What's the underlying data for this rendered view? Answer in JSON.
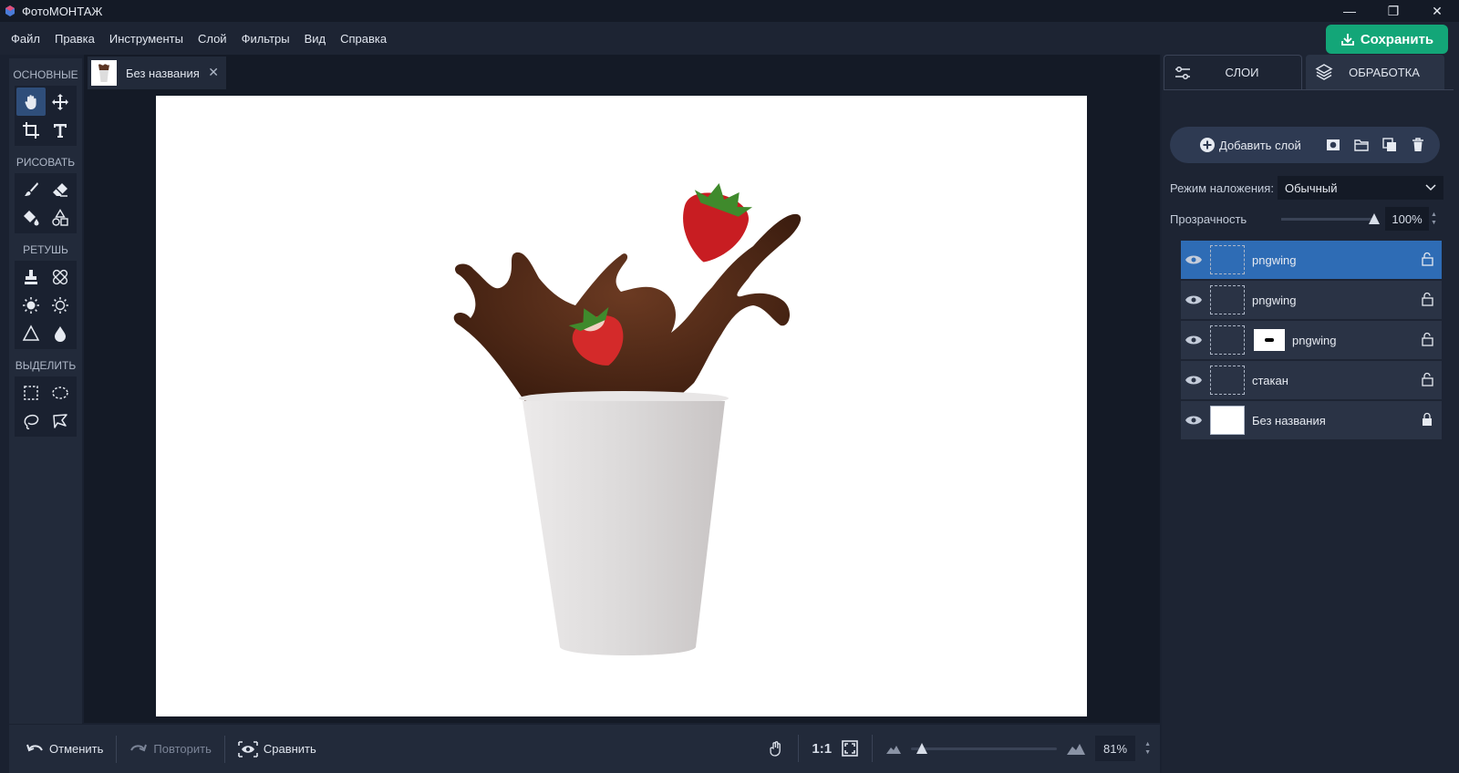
{
  "app": {
    "title": "ФотоМОНТАЖ",
    "window_controls": [
      "—",
      "❐",
      "✕"
    ]
  },
  "menu": {
    "items": [
      "Файл",
      "Правка",
      "Инструменты",
      "Слой",
      "Фильтры",
      "Вид",
      "Справка"
    ],
    "save_label": "Сохранить"
  },
  "toolbar": {
    "sections": [
      {
        "label": "ОСНОВНЫЕ",
        "tools": [
          "hand-icon",
          "move-icon",
          "crop-icon",
          "text-icon"
        ]
      },
      {
        "label": "РИСОВАТЬ",
        "tools": [
          "brush-icon",
          "eraser-icon",
          "fill-icon",
          "shapes-icon"
        ]
      },
      {
        "label": "РЕТУШЬ",
        "tools": [
          "stamp-icon",
          "healing-icon",
          "brighten-icon",
          "darken-icon",
          "sharpen-icon",
          "blur-icon"
        ]
      },
      {
        "label": "ВЫДЕЛИТЬ",
        "tools": [
          "rect-select-icon",
          "ellipse-select-icon",
          "lasso-icon",
          "polygon-lasso-icon"
        ]
      }
    ],
    "active_tool": "hand-icon"
  },
  "document": {
    "tab_name": "Без названия",
    "close_glyph": "✕"
  },
  "bottom": {
    "undo_label": "Отменить",
    "redo_label": "Повторить",
    "compare_label": "Сравнить",
    "one_to_one": "1:1",
    "zoom_value": "81%",
    "zoom_fraction": 0.04
  },
  "panel": {
    "tabs": [
      {
        "label": "СЛОИ",
        "icon": "sliders-icon",
        "active": true
      },
      {
        "label": "ОБРАБОТКА",
        "icon": "layers-icon",
        "active": false
      }
    ],
    "add_layer_label": "Добавить слой",
    "blend_label": "Режим наложения:",
    "blend_value": "Обычный",
    "opacity_label": "Прозрачность",
    "opacity_value": "100%",
    "layers": [
      {
        "name": "pngwing",
        "selected": true,
        "mask": false,
        "locked": false
      },
      {
        "name": "pngwing",
        "selected": false,
        "mask": false,
        "locked": false
      },
      {
        "name": "pngwing",
        "selected": false,
        "mask": true,
        "locked": false
      },
      {
        "name": "стакан",
        "selected": false,
        "mask": false,
        "locked": false
      },
      {
        "name": "Без названия",
        "selected": false,
        "mask": false,
        "locked": true
      }
    ]
  },
  "colors": {
    "accent_green": "#13a678",
    "selected_layer": "#2e6cb5",
    "background": "#1a2130"
  }
}
